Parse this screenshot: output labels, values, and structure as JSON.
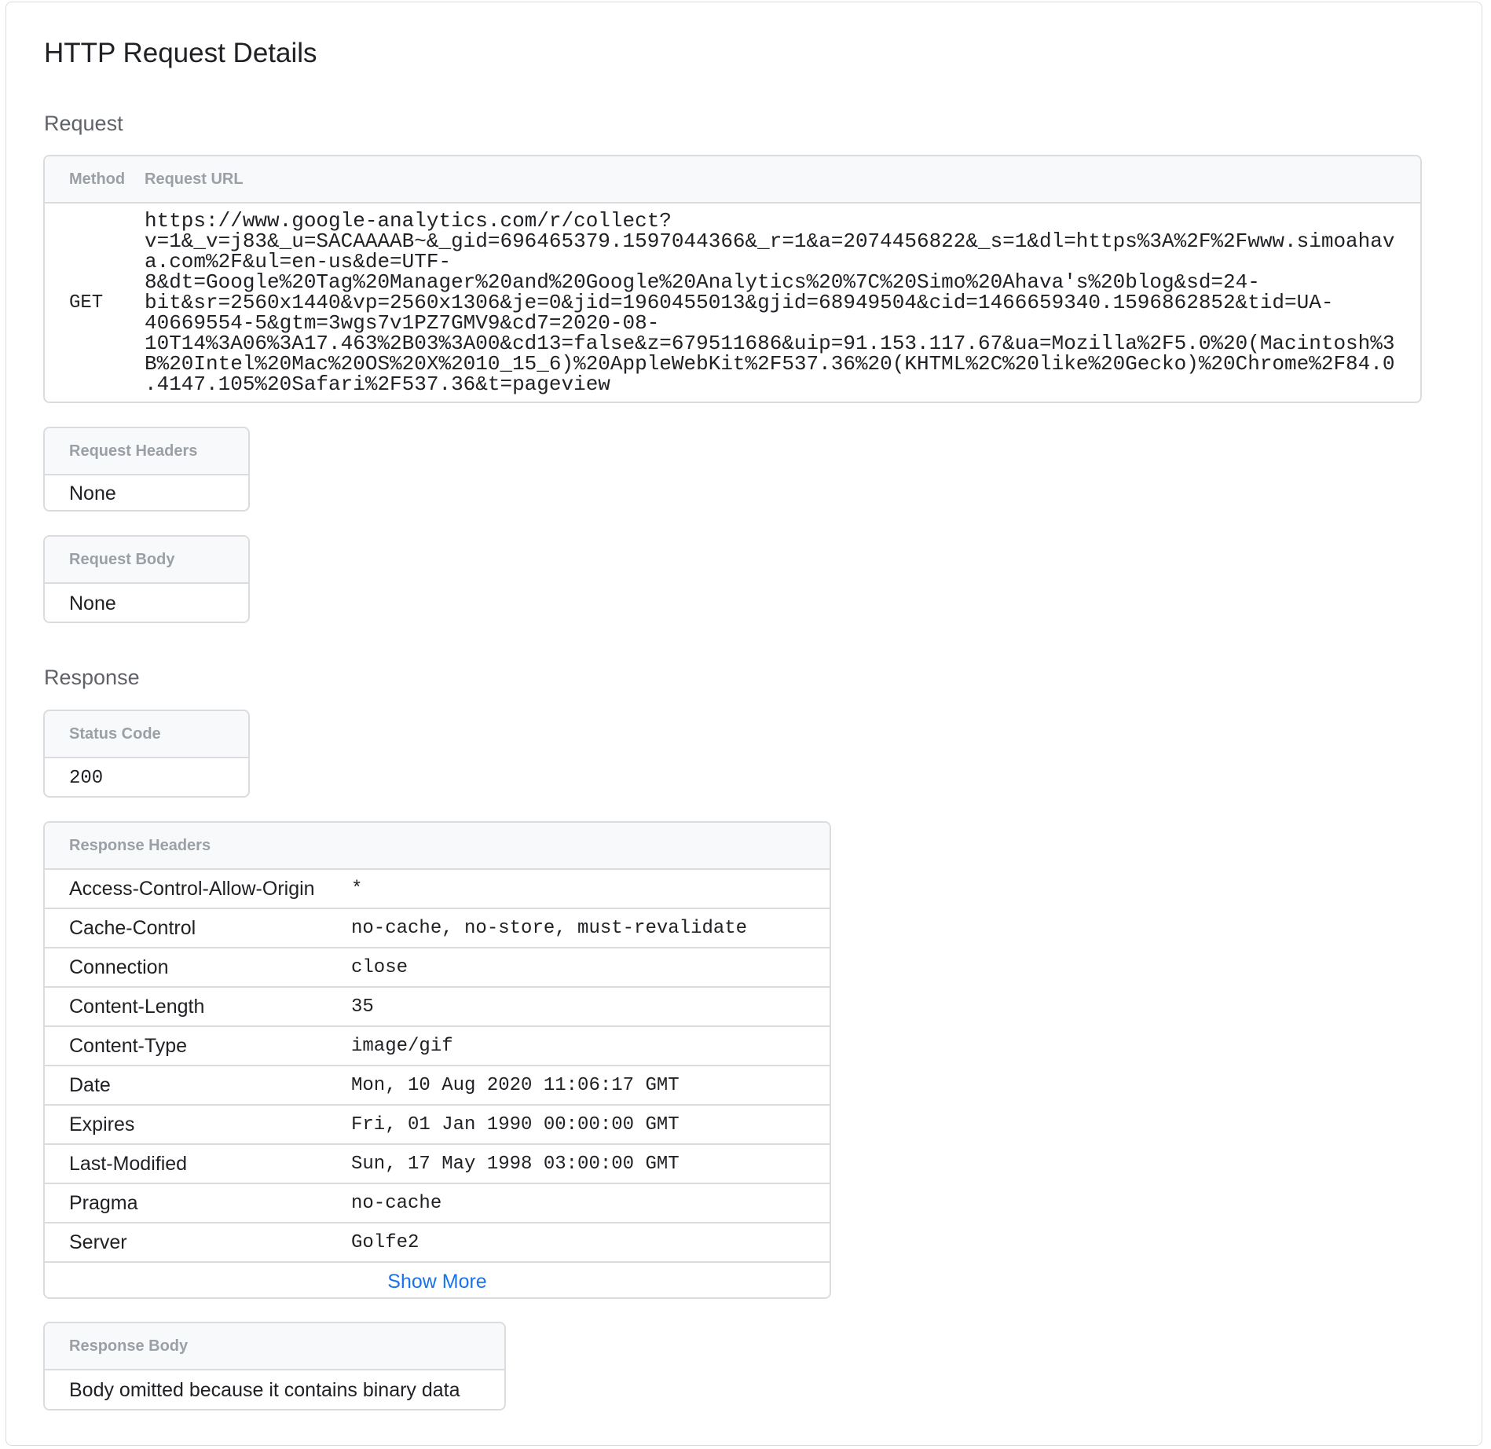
{
  "page": {
    "title": "HTTP Request Details"
  },
  "request": {
    "section_label": "Request",
    "table": {
      "method_header": "Method",
      "url_header": "Request URL",
      "method": "GET",
      "url": "https://www.google-analytics.com/r/collect?v=1&_v=j83&_u=SACAAAAB~&_gid=696465379.1597044366&_r=1&a=2074456822&_s=1&dl=https%3A%2F%2Fwww.simoahava.com%2F&ul=en-us&de=UTF-8&dt=Google%20Tag%20Manager%20and%20Google%20Analytics%20%7C%20Simo%20Ahava's%20blog&sd=24-bit&sr=2560x1440&vp=2560x1306&je=0&jid=1960455013&gjid=68949504&cid=1466659340.1596862852&tid=UA-40669554-5&gtm=3wgs7v1PZ7GMV9&cd7=2020-08-10T14%3A06%3A17.463%2B03%3A00&cd13=false&z=679511686&uip=91.153.117.67&ua=Mozilla%2F5.0%20(Macintosh%3B%20Intel%20Mac%20OS%20X%2010_15_6)%20AppleWebKit%2F537.36%20(KHTML%2C%20like%20Gecko)%20Chrome%2F84.0.4147.105%20Safari%2F537.36&t=pageview"
    },
    "headers": {
      "label": "Request Headers",
      "value": "None"
    },
    "body": {
      "label": "Request Body",
      "value": "None"
    }
  },
  "response": {
    "section_label": "Response",
    "status": {
      "label": "Status Code",
      "value": "200"
    },
    "headers": {
      "label": "Response Headers",
      "rows": [
        {
          "name": "Access-Control-Allow-Origin",
          "value": "*"
        },
        {
          "name": "Cache-Control",
          "value": "no-cache, no-store, must-revalidate"
        },
        {
          "name": "Connection",
          "value": "close"
        },
        {
          "name": "Content-Length",
          "value": "35"
        },
        {
          "name": "Content-Type",
          "value": "image/gif"
        },
        {
          "name": "Date",
          "value": "Mon, 10 Aug 2020 11:06:17 GMT"
        },
        {
          "name": "Expires",
          "value": "Fri, 01 Jan 1990 00:00:00 GMT"
        },
        {
          "name": "Last-Modified",
          "value": "Sun, 17 May 1998 03:00:00 GMT"
        },
        {
          "name": "Pragma",
          "value": "no-cache"
        },
        {
          "name": "Server",
          "value": "Golfe2"
        }
      ],
      "show_more_label": "Show More"
    },
    "body": {
      "label": "Response Body",
      "value": "Body omitted because it contains binary data"
    }
  },
  "colors": {
    "link": "#1a73e8",
    "header_text": "#9aa0a6",
    "border": "#dadce0",
    "header_bg": "#f8f9fa"
  }
}
